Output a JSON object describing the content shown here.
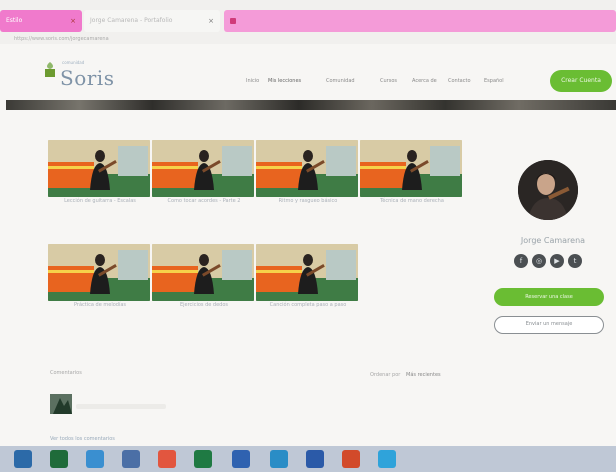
{
  "browser": {
    "tabs": [
      {
        "label": "Estilo",
        "close": "×",
        "color": "#f07acc"
      },
      {
        "label": "Jorge Camarena - Portafolio",
        "close": "×",
        "color": "#f6f6f4"
      },
      {
        "label": "",
        "close": "",
        "color": "#f49bd8"
      }
    ],
    "address": "https://www.soris.com/jorgecamarena"
  },
  "site": {
    "logo_text": "Soris",
    "logo_small": "comunidad",
    "nav": [
      "Inicio",
      "Mis lecciones",
      "Comunidad",
      "Cursos",
      "Acerca de",
      "Contacto",
      "Español"
    ],
    "cta": "Crear Cuenta"
  },
  "videos": [
    {
      "title": "Lección de guitarra - Escalas"
    },
    {
      "title": "Como tocar acordes - Parte 2"
    },
    {
      "title": "Ritmo y rasgueo básico"
    },
    {
      "title": "Técnica de mano derecha"
    },
    {
      "title": "Práctica de melodías"
    },
    {
      "title": "Ejercicios de dedos"
    },
    {
      "title": "Canción completa paso a paso"
    }
  ],
  "profile": {
    "name": "Jorge Camarena",
    "social_icons": [
      "facebook-icon",
      "instagram-icon",
      "youtube-icon",
      "twitter-icon"
    ],
    "primary_button": "Reservar una clase",
    "secondary_button": "Enviar un mensaje"
  },
  "reviews": {
    "label": "Comentarios",
    "filter_label": "Ordenar por",
    "filter_value": "Más recientes",
    "footer_link": "Ver todos los comentarios"
  },
  "taskbar": {
    "icons": [
      "start-icon",
      "store-icon",
      "files-icon",
      "mail-icon",
      "chrome-icon",
      "excel-icon",
      "outlook-icon",
      "edge-icon",
      "word-icon",
      "powerpoint-icon",
      "skype-icon"
    ]
  },
  "colors": {
    "accent_green": "#6abd33",
    "tab_pink": "#f07acc",
    "taskbar": "#bfc8d6"
  }
}
